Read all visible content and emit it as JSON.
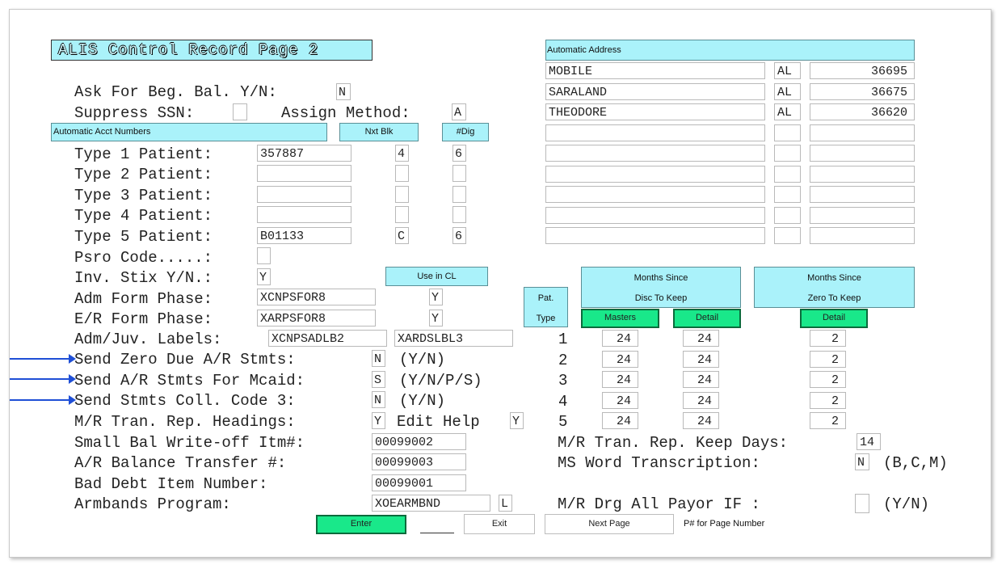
{
  "title": "ALIS Control Record Page 2",
  "ask_beg_bal": {
    "label": "Ask For Beg. Bal. Y/N:",
    "value": "N"
  },
  "suppress_ssn": {
    "label": "Suppress SSN:",
    "value": ""
  },
  "assign_method": {
    "label": "Assign Method:",
    "value": "A"
  },
  "acct_header": {
    "title": "Automatic Acct Numbers",
    "nxt": "Nxt Blk",
    "dig": "#Dig"
  },
  "patients": [
    {
      "label": "Type 1 Patient:",
      "num": "357887",
      "nxt": "4",
      "dig": "6"
    },
    {
      "label": "Type 2 Patient:",
      "num": "",
      "nxt": "",
      "dig": ""
    },
    {
      "label": "Type 3 Patient:",
      "num": "",
      "nxt": "",
      "dig": ""
    },
    {
      "label": "Type 4 Patient:",
      "num": "",
      "nxt": "",
      "dig": ""
    },
    {
      "label": "Type 5 Patient:",
      "num": "B01133",
      "nxt": "C",
      "dig": "6"
    }
  ],
  "psro": {
    "label": "Psro Code.....:",
    "value": ""
  },
  "inv_stix": {
    "label": "Inv. Stix Y/N.:",
    "value": "Y"
  },
  "use_in_cl": "Use in CL",
  "adm_form": {
    "label": "Adm Form Phase:",
    "value": "XCNPSFOR8",
    "cl": "Y"
  },
  "er_form": {
    "label": "E/R Form Phase:",
    "value": "XARPSFOR8",
    "cl": "Y"
  },
  "adm_juv": {
    "label": "Adm/Juv. Labels:",
    "value1": "XCNPSADLB2",
    "value2": "XARDSLBL3"
  },
  "send_zero": {
    "label": "Send Zero Due A/R Stmts:",
    "value": "N",
    "hint": "(Y/N)"
  },
  "send_mcaid": {
    "label": "Send A/R Stmts For Mcaid:",
    "value": "S",
    "hint": "(Y/N/P/S)"
  },
  "send_coll": {
    "label": "Send Stmts Coll. Code 3:",
    "value": "N",
    "hint": "(Y/N)"
  },
  "mr_headings": {
    "label": "M/R Tran. Rep. Headings:",
    "value": "Y",
    "edit_label": "Edit Help",
    "edit_value": "Y"
  },
  "small_bal": {
    "label": "Small Bal Write-off Itm#:",
    "value": "00099002"
  },
  "ar_transfer": {
    "label": "A/R Balance Transfer #:",
    "value": "00099003"
  },
  "bad_debt": {
    "label": "Bad Debt Item Number:",
    "value": "00099001"
  },
  "armbands": {
    "label": "Armbands Program:",
    "value": "XOEARMBND",
    "flag": "L"
  },
  "auto_address": {
    "title": "Automatic Address",
    "rows": [
      {
        "city": "MOBILE",
        "state": "AL",
        "zip": "36695"
      },
      {
        "city": "SARALAND",
        "state": "AL",
        "zip": "36675"
      },
      {
        "city": "THEODORE",
        "state": "AL",
        "zip": "36620"
      },
      {
        "city": "",
        "state": "",
        "zip": ""
      },
      {
        "city": "",
        "state": "",
        "zip": ""
      },
      {
        "city": "",
        "state": "",
        "zip": ""
      },
      {
        "city": "",
        "state": "",
        "zip": ""
      },
      {
        "city": "",
        "state": "",
        "zip": ""
      },
      {
        "city": "",
        "state": "",
        "zip": ""
      }
    ]
  },
  "months_table": {
    "pat_type_label1": "Pat.",
    "pat_type_label2": "Type",
    "disc_header1": "Months Since",
    "disc_header2": "Disc To Keep",
    "zero_header1": "Months Since",
    "zero_header2": "Zero To Keep",
    "masters_btn": "Masters",
    "detail_btn": "Detail",
    "zero_detail_btn": "Detail",
    "rows": [
      {
        "type": "1",
        "masters": "24",
        "detail": "24",
        "zero": "2"
      },
      {
        "type": "2",
        "masters": "24",
        "detail": "24",
        "zero": "2"
      },
      {
        "type": "3",
        "masters": "24",
        "detail": "24",
        "zero": "2"
      },
      {
        "type": "4",
        "masters": "24",
        "detail": "24",
        "zero": "2"
      },
      {
        "type": "5",
        "masters": "24",
        "detail": "24",
        "zero": "2"
      }
    ]
  },
  "mr_keep_days": {
    "label": "M/R Tran. Rep. Keep Days:",
    "value": "14"
  },
  "ms_word": {
    "label": "MS Word Transcription:",
    "value": "N",
    "hint": "(B,C,M)"
  },
  "mr_drg": {
    "label": "M/R Drg All Payor IF :",
    "value": "",
    "hint": "(Y/N)"
  },
  "footer": {
    "enter": "Enter",
    "exit": "Exit",
    "next": "Next Page",
    "page_hint": "P# for Page Number"
  },
  "colors": {
    "header_bg": "#aaf2fa",
    "button_green": "#19e88a",
    "arrow_blue": "#1f4fd6"
  }
}
